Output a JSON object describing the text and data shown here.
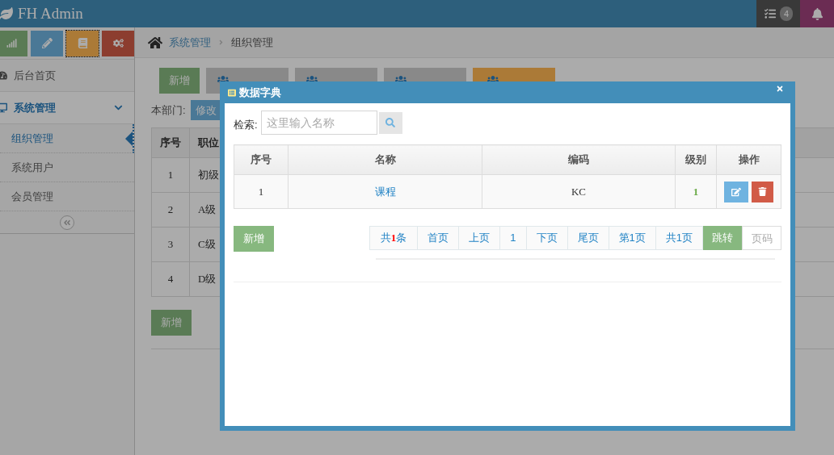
{
  "header": {
    "logo": "FH Admin",
    "badge": "4"
  },
  "sidebar": {
    "items": [
      {
        "label": "后台首页",
        "expanded": false
      },
      {
        "label": "系统管理",
        "expanded": true,
        "children": [
          {
            "label": "组织管理",
            "selected": true
          },
          {
            "label": "系统用户",
            "selected": false
          },
          {
            "label": "会员管理",
            "selected": false
          }
        ]
      }
    ]
  },
  "breadcrumb": [
    "系统管理",
    "组织管理"
  ],
  "toolbar": {
    "add": "新增",
    "tabs": [
      {
        "kind": "default"
      },
      {
        "kind": "default"
      },
      {
        "kind": "default"
      },
      {
        "kind": "warning"
      }
    ]
  },
  "department": {
    "label": "本部门:",
    "edit": "修改"
  },
  "table": {
    "columns": [
      "序号",
      "职位"
    ],
    "rows": [
      [
        "1",
        "初级"
      ],
      [
        "2",
        "A级"
      ],
      [
        "3",
        "C级"
      ],
      [
        "4",
        "D级"
      ]
    ]
  },
  "bottom_add": "新增",
  "dialog": {
    "title": "数据字典",
    "search_label": "检索:",
    "placeholder": "这里输入名称",
    "columns": [
      "序号",
      "名称",
      "编码",
      "级别",
      "操作"
    ],
    "rows": [
      {
        "index": "1",
        "name": "课程",
        "code": "KC",
        "level": "1"
      }
    ],
    "add": "新增",
    "pagination": [
      {
        "kind": "total",
        "prefix": "共",
        "count": "1",
        "suffix": "条"
      },
      {
        "kind": "link",
        "text": "首页"
      },
      {
        "kind": "link",
        "text": "上页"
      },
      {
        "kind": "link",
        "text": "1"
      },
      {
        "kind": "link",
        "text": "下页"
      },
      {
        "kind": "link",
        "text": "尾页"
      },
      {
        "kind": "link",
        "text": "第1页"
      },
      {
        "kind": "link",
        "text": "共1页"
      },
      {
        "kind": "go",
        "text": "跳转"
      },
      {
        "kind": "input",
        "placeholder": "页码"
      }
    ]
  }
}
